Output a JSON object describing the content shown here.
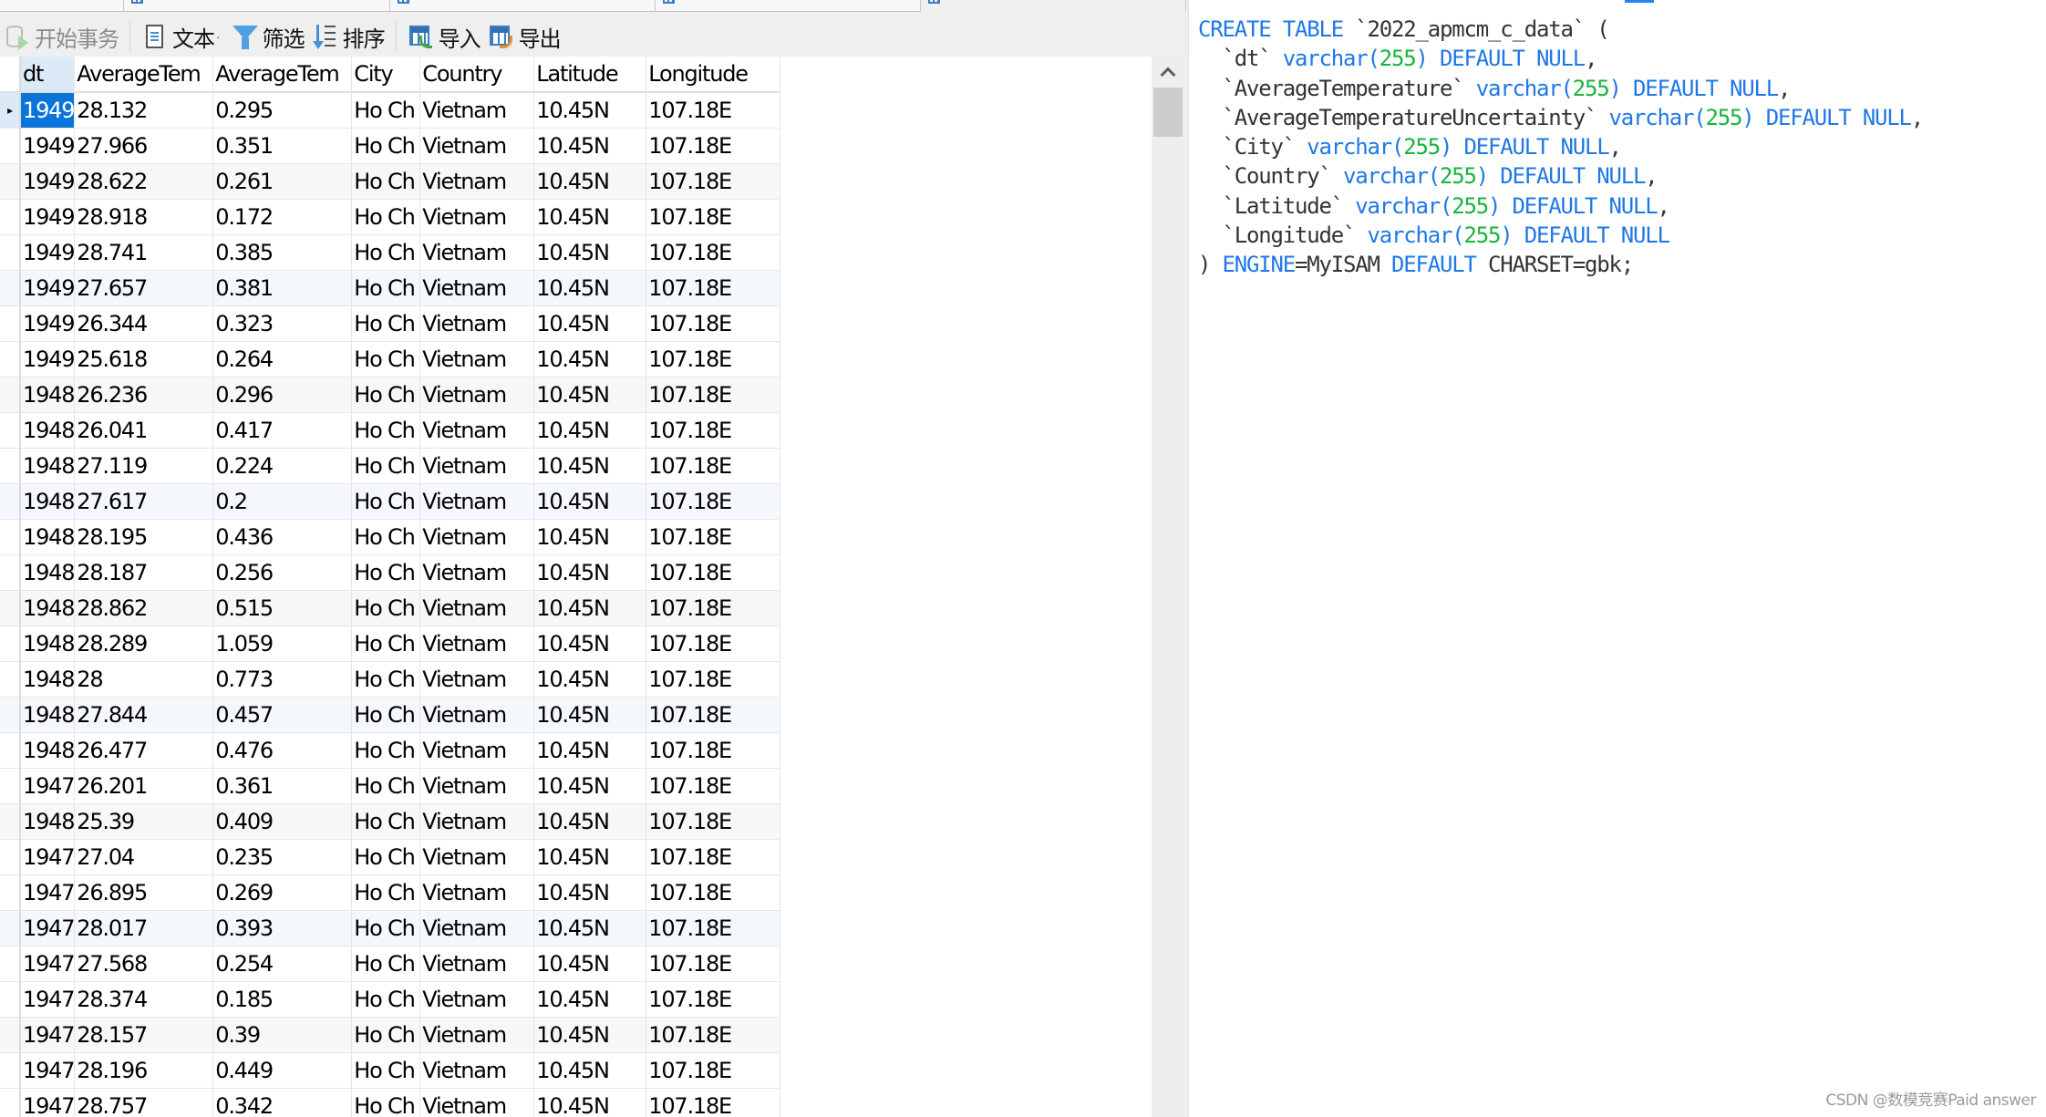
{
  "toolbar": {
    "begin_transaction": "开始事务",
    "text": "文本",
    "text_dropdown": "·",
    "filter": "筛选",
    "sort": "排序",
    "import": "导入",
    "export": "导出",
    "icons": {
      "begin_transaction": "database-play-icon",
      "text": "document-icon",
      "filter": "funnel-icon",
      "sort": "sort-descending-icon",
      "import": "table-import-icon",
      "export": "table-export-icon"
    }
  },
  "grid": {
    "columns": [
      "dt",
      "AverageTem",
      "AverageTem",
      "City",
      "Country",
      "Latitude",
      "Longitude"
    ],
    "selected_cell": {
      "row": 0,
      "column": "dt"
    },
    "rows": [
      [
        "1949",
        "28.132",
        "0.295",
        "Ho Ch",
        "Vietnam",
        "10.45N",
        "107.18E"
      ],
      [
        "1949",
        "27.966",
        "0.351",
        "Ho Ch",
        "Vietnam",
        "10.45N",
        "107.18E"
      ],
      [
        "1949",
        "28.622",
        "0.261",
        "Ho Ch",
        "Vietnam",
        "10.45N",
        "107.18E"
      ],
      [
        "1949",
        "28.918",
        "0.172",
        "Ho Ch",
        "Vietnam",
        "10.45N",
        "107.18E"
      ],
      [
        "1949",
        "28.741",
        "0.385",
        "Ho Ch",
        "Vietnam",
        "10.45N",
        "107.18E"
      ],
      [
        "1949",
        "27.657",
        "0.381",
        "Ho Ch",
        "Vietnam",
        "10.45N",
        "107.18E"
      ],
      [
        "1949",
        "26.344",
        "0.323",
        "Ho Ch",
        "Vietnam",
        "10.45N",
        "107.18E"
      ],
      [
        "1949",
        "25.618",
        "0.264",
        "Ho Ch",
        "Vietnam",
        "10.45N",
        "107.18E"
      ],
      [
        "1948",
        "26.236",
        "0.296",
        "Ho Ch",
        "Vietnam",
        "10.45N",
        "107.18E"
      ],
      [
        "1948",
        "26.041",
        "0.417",
        "Ho Ch",
        "Vietnam",
        "10.45N",
        "107.18E"
      ],
      [
        "1948",
        "27.119",
        "0.224",
        "Ho Ch",
        "Vietnam",
        "10.45N",
        "107.18E"
      ],
      [
        "1948",
        "27.617",
        "0.2",
        "Ho Ch",
        "Vietnam",
        "10.45N",
        "107.18E"
      ],
      [
        "1948",
        "28.195",
        "0.436",
        "Ho Ch",
        "Vietnam",
        "10.45N",
        "107.18E"
      ],
      [
        "1948",
        "28.187",
        "0.256",
        "Ho Ch",
        "Vietnam",
        "10.45N",
        "107.18E"
      ],
      [
        "1948",
        "28.862",
        "0.515",
        "Ho Ch",
        "Vietnam",
        "10.45N",
        "107.18E"
      ],
      [
        "1948",
        "28.289",
        "1.059",
        "Ho Ch",
        "Vietnam",
        "10.45N",
        "107.18E"
      ],
      [
        "1948",
        "28",
        "0.773",
        "Ho Ch",
        "Vietnam",
        "10.45N",
        "107.18E"
      ],
      [
        "1948",
        "27.844",
        "0.457",
        "Ho Ch",
        "Vietnam",
        "10.45N",
        "107.18E"
      ],
      [
        "1948",
        "26.477",
        "0.476",
        "Ho Ch",
        "Vietnam",
        "10.45N",
        "107.18E"
      ],
      [
        "1947",
        "26.201",
        "0.361",
        "Ho Ch",
        "Vietnam",
        "10.45N",
        "107.18E"
      ],
      [
        "1948",
        "25.39",
        "0.409",
        "Ho Ch",
        "Vietnam",
        "10.45N",
        "107.18E"
      ],
      [
        "1947",
        "27.04",
        "0.235",
        "Ho Ch",
        "Vietnam",
        "10.45N",
        "107.18E"
      ],
      [
        "1947",
        "26.895",
        "0.269",
        "Ho Ch",
        "Vietnam",
        "10.45N",
        "107.18E"
      ],
      [
        "1947",
        "28.017",
        "0.393",
        "Ho Ch",
        "Vietnam",
        "10.45N",
        "107.18E"
      ],
      [
        "1947",
        "27.568",
        "0.254",
        "Ho Ch",
        "Vietnam",
        "10.45N",
        "107.18E"
      ],
      [
        "1947",
        "28.374",
        "0.185",
        "Ho Ch",
        "Vietnam",
        "10.45N",
        "107.18E"
      ],
      [
        "1947",
        "28.157",
        "0.39",
        "Ho Ch",
        "Vietnam",
        "10.45N",
        "107.18E"
      ],
      [
        "1947",
        "28.196",
        "0.449",
        "Ho Ch",
        "Vietnam",
        "10.45N",
        "107.18E"
      ],
      [
        "1947",
        "28.757",
        "0.342",
        "Ho Ch",
        "Vietnam",
        "10.45N",
        "107.18E"
      ]
    ]
  },
  "ddl": {
    "lines": [
      [
        [
          "kw",
          "CREATE TABLE"
        ],
        [
          "id",
          " `2022_apmcm_c_data` ("
        ]
      ],
      [
        [
          "id",
          "  `dt` "
        ],
        [
          "kw",
          "varchar("
        ],
        [
          "num",
          "255"
        ],
        [
          "kw",
          ") DEFAULT NULL"
        ],
        [
          "id",
          ","
        ]
      ],
      [
        [
          "id",
          "  `AverageTemperature` "
        ],
        [
          "kw",
          "varchar("
        ],
        [
          "num",
          "255"
        ],
        [
          "kw",
          ") DEFAULT NULL"
        ],
        [
          "id",
          ","
        ]
      ],
      [
        [
          "id",
          "  `AverageTemperatureUncertainty` "
        ],
        [
          "kw",
          "varchar("
        ],
        [
          "num",
          "255"
        ],
        [
          "kw",
          ") DEFAULT NULL"
        ],
        [
          "id",
          ","
        ]
      ],
      [
        [
          "id",
          "  `City` "
        ],
        [
          "kw",
          "varchar("
        ],
        [
          "num",
          "255"
        ],
        [
          "kw",
          ") DEFAULT NULL"
        ],
        [
          "id",
          ","
        ]
      ],
      [
        [
          "id",
          "  `Country` "
        ],
        [
          "kw",
          "varchar("
        ],
        [
          "num",
          "255"
        ],
        [
          "kw",
          ") DEFAULT NULL"
        ],
        [
          "id",
          ","
        ]
      ],
      [
        [
          "id",
          "  `Latitude` "
        ],
        [
          "kw",
          "varchar("
        ],
        [
          "num",
          "255"
        ],
        [
          "kw",
          ") DEFAULT NULL"
        ],
        [
          "id",
          ","
        ]
      ],
      [
        [
          "id",
          "  `Longitude` "
        ],
        [
          "kw",
          "varchar("
        ],
        [
          "num",
          "255"
        ],
        [
          "kw",
          ") DEFAULT NULL"
        ]
      ],
      [
        [
          "id",
          ") "
        ],
        [
          "kw",
          "ENGINE"
        ],
        [
          "id",
          "=MyISAM "
        ],
        [
          "kw",
          "DEFAULT"
        ],
        [
          "id",
          " CHARSET=gbk;"
        ]
      ]
    ]
  },
  "colors": {
    "keyword": "#1f78e6",
    "number": "#18b33c",
    "selection": "#0a74da"
  },
  "watermark": "CSDN @数模竞赛Paid answer"
}
